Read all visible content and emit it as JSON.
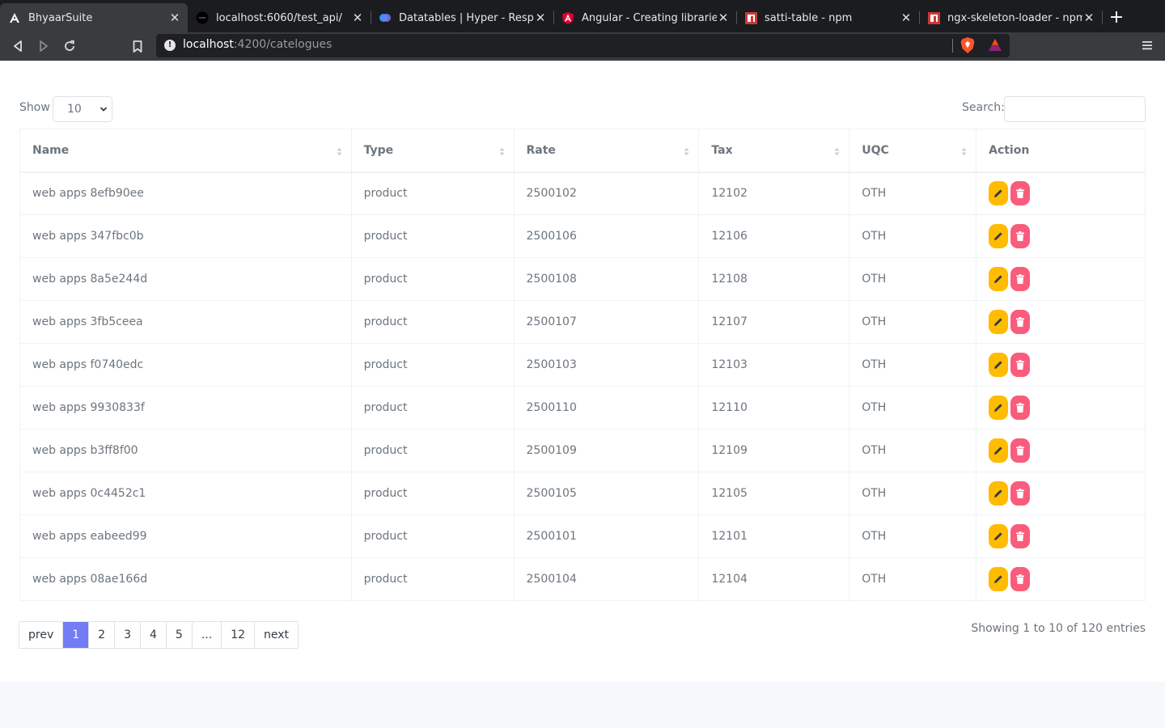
{
  "browser": {
    "tabs": [
      {
        "title": "BhyaarSuite",
        "favicon": "angular-a-icon",
        "active": true
      },
      {
        "title": "localhost:6060/test_api/",
        "favicon": "black-dot-icon",
        "active": false
      },
      {
        "title": "Datatables | Hyper - Responsi",
        "favicon": "hyper-logo-icon",
        "active": false
      },
      {
        "title": "Angular - Creating libraries",
        "favicon": "angular-shield-icon",
        "active": false
      },
      {
        "title": "satti-table - npm",
        "favicon": "npm-icon",
        "active": false
      },
      {
        "title": "ngx-skeleton-loader - npm",
        "favicon": "npm-icon",
        "active": false
      }
    ],
    "url_host": "localhost",
    "url_path": ":4200/catelogues"
  },
  "table_controls": {
    "show_label": "Show",
    "page_length": "10",
    "search_label": "Search:",
    "search_value": ""
  },
  "table": {
    "columns": [
      "Name",
      "Type",
      "Rate",
      "Tax",
      "UQC",
      "Action"
    ],
    "rows": [
      {
        "name": "web apps 8efb90ee",
        "type": "product",
        "rate": "2500102",
        "tax": "12102",
        "uqc": "OTH"
      },
      {
        "name": "web apps 347fbc0b",
        "type": "product",
        "rate": "2500106",
        "tax": "12106",
        "uqc": "OTH"
      },
      {
        "name": "web apps 8a5e244d",
        "type": "product",
        "rate": "2500108",
        "tax": "12108",
        "uqc": "OTH"
      },
      {
        "name": "web apps 3fb5ceea",
        "type": "product",
        "rate": "2500107",
        "tax": "12107",
        "uqc": "OTH"
      },
      {
        "name": "web apps f0740edc",
        "type": "product",
        "rate": "2500103",
        "tax": "12103",
        "uqc": "OTH"
      },
      {
        "name": "web apps 9930833f",
        "type": "product",
        "rate": "2500110",
        "tax": "12110",
        "uqc": "OTH"
      },
      {
        "name": "web apps b3ff8f00",
        "type": "product",
        "rate": "2500109",
        "tax": "12109",
        "uqc": "OTH"
      },
      {
        "name": "web apps 0c4452c1",
        "type": "product",
        "rate": "2500105",
        "tax": "12105",
        "uqc": "OTH"
      },
      {
        "name": "web apps eabeed99",
        "type": "product",
        "rate": "2500101",
        "tax": "12101",
        "uqc": "OTH"
      },
      {
        "name": "web apps 08ae166d",
        "type": "product",
        "rate": "2500104",
        "tax": "12104",
        "uqc": "OTH"
      }
    ]
  },
  "pagination": {
    "items": [
      "prev",
      "1",
      "2",
      "3",
      "4",
      "5",
      "...",
      "12",
      "next"
    ],
    "current": "1"
  },
  "info_text": "Showing 1 to 10 of 120 entries",
  "colors": {
    "accent": "#727cf5",
    "edit": "#ffbc00",
    "delete": "#fa5c7c"
  }
}
